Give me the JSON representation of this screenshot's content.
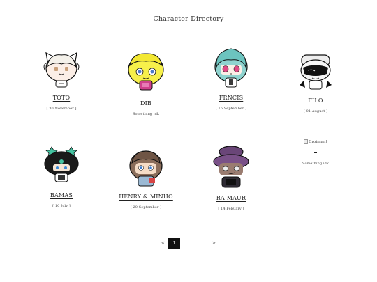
{
  "page": {
    "title": "Character Directory"
  },
  "characters": [
    {
      "name": "TOTO",
      "sub": "[ 30 November ]"
    },
    {
      "name": "DIB",
      "sub": "Something idk"
    },
    {
      "name": "FRNCIS",
      "sub": "[ 16 September ]"
    },
    {
      "name": "FILO",
      "sub": "[ 01 August ]"
    },
    {
      "name": "BAMAS",
      "sub": "[ 10 July ]"
    },
    {
      "name": "HENRY & MINHO",
      "sub": "[ 20 September ]"
    },
    {
      "name": "RA MAUR",
      "sub": "[ 14 Febuary ]"
    },
    {
      "alt": "Croissant",
      "name": "",
      "sub": "Something idk"
    }
  ],
  "pagination": {
    "prev": "«",
    "current": "1",
    "next": "»"
  },
  "icons": {
    "toto": "character-avatar-toto",
    "dib": "character-avatar-dib",
    "frncis": "character-avatar-frncis",
    "filo": "character-avatar-filo",
    "bamas": "character-avatar-bamas",
    "henry": "character-avatar-henry-minho",
    "ramaur": "character-avatar-ra-maur",
    "croissant": "broken-image-icon"
  }
}
